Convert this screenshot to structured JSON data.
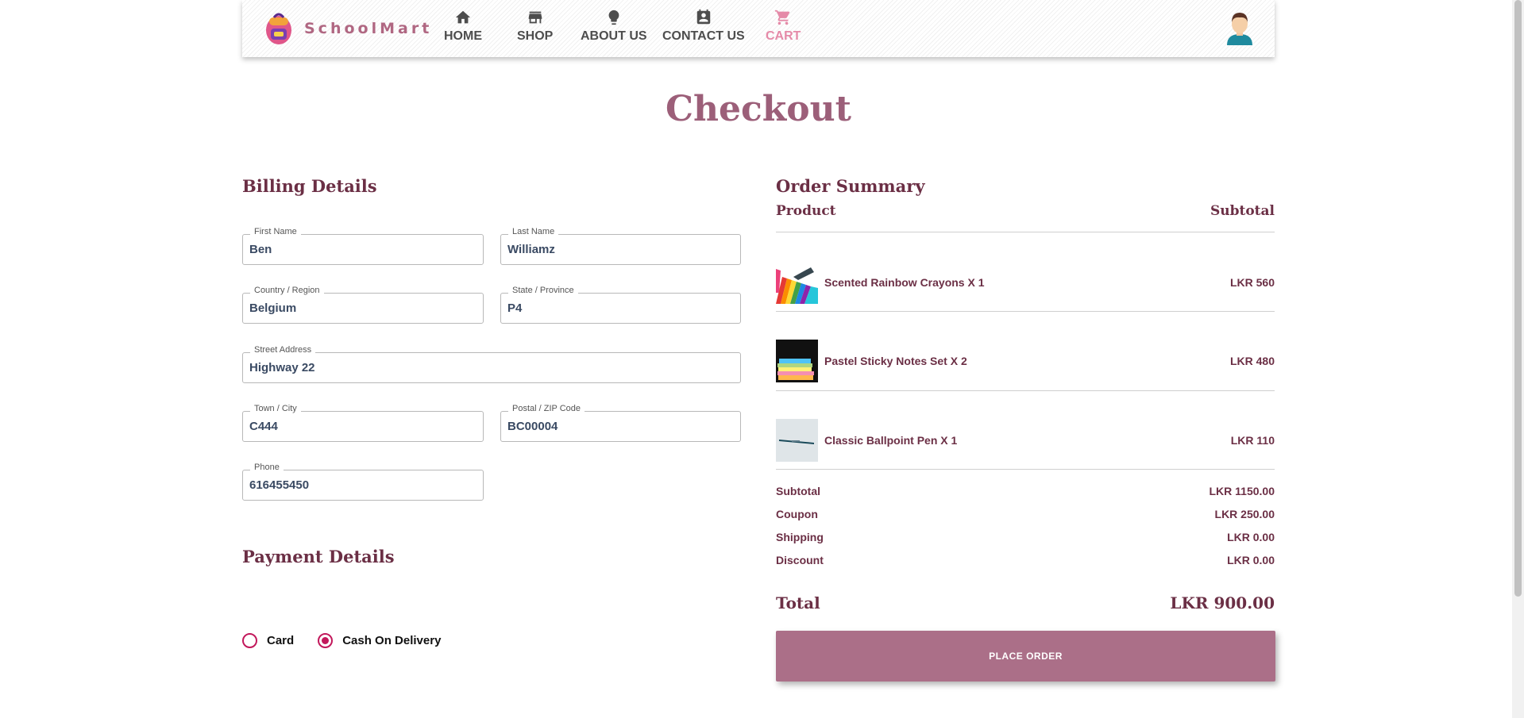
{
  "header": {
    "brand": "SchoolMart",
    "nav": [
      {
        "label": "HOME",
        "icon": "home-icon"
      },
      {
        "label": "SHOP",
        "icon": "store-icon"
      },
      {
        "label": "ABOUT US",
        "icon": "lightbulb-icon"
      },
      {
        "label": "CONTACT US",
        "icon": "contact-card-icon"
      },
      {
        "label": "CART",
        "icon": "cart-icon",
        "active": true
      }
    ],
    "avatar": "user-avatar-icon"
  },
  "page_title": "Checkout",
  "billing": {
    "title": "Billing Details",
    "fields": {
      "first_name": {
        "label": "First Name",
        "value": "Ben"
      },
      "last_name": {
        "label": "Last Name",
        "value": "Williamz"
      },
      "country": {
        "label": "Country / Region",
        "value": "Belgium"
      },
      "state": {
        "label": "State / Province",
        "value": "P4"
      },
      "street": {
        "label": "Street Address",
        "value": "Highway 22"
      },
      "town": {
        "label": "Town / City",
        "value": "C444"
      },
      "postal": {
        "label": "Postal / ZIP Code",
        "value": "BC00004"
      },
      "phone": {
        "label": "Phone",
        "value": "616455450"
      }
    }
  },
  "payment": {
    "title": "Payment Details",
    "options": [
      {
        "label": "Card",
        "selected": false
      },
      {
        "label": "Cash On Delivery",
        "selected": true
      }
    ]
  },
  "summary": {
    "title": "Order Summary",
    "col_product": "Product",
    "col_subtotal": "Subtotal",
    "items": [
      {
        "name": "Scented Rainbow Crayons X 1",
        "price": "LKR 560",
        "thumb": "crayons-image"
      },
      {
        "name": "Pastel Sticky Notes Set X 2",
        "price": "LKR 480",
        "thumb": "sticky-notes-image"
      },
      {
        "name": "Classic Ballpoint Pen X 1",
        "price": "LKR 110",
        "thumb": "pen-image"
      }
    ],
    "totals": [
      {
        "label": "Subtotal",
        "value": "LKR 1150.00"
      },
      {
        "label": "Coupon",
        "value": "LKR 250.00"
      },
      {
        "label": "Shipping",
        "value": "LKR 0.00"
      },
      {
        "label": "Discount",
        "value": "LKR 0.00"
      }
    ],
    "total_label": "Total",
    "total_value": "LKR 900.00",
    "place_order": "PLACE ORDER"
  },
  "colors": {
    "accent": "#ab6f88",
    "heading": "#6b2f45",
    "title": "#9c5f79",
    "radio": "#c2185b",
    "nav_active": "#e58aa8"
  }
}
